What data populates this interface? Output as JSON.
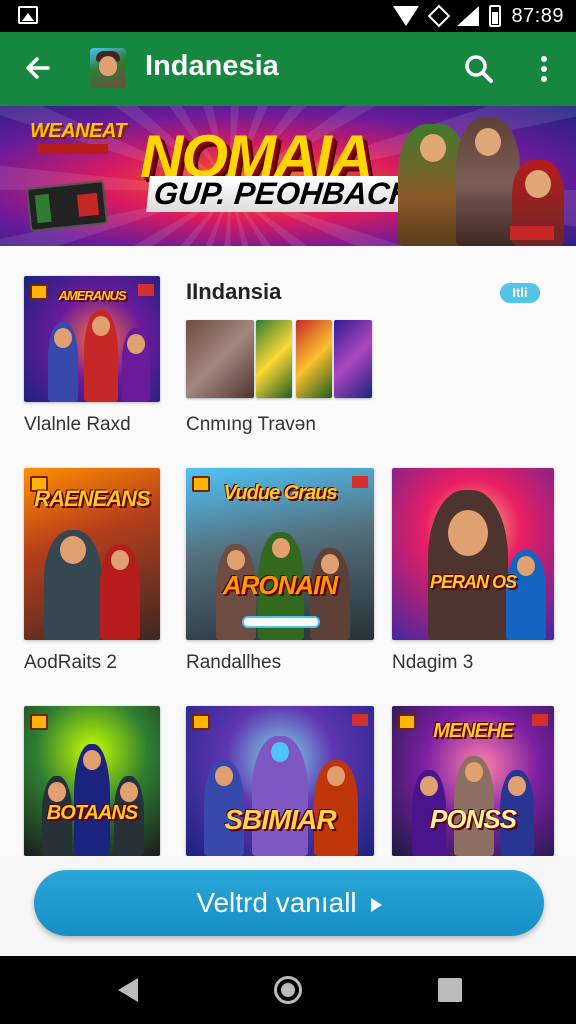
{
  "status_bar": {
    "time": "87:89"
  },
  "app_bar": {
    "title": "Indanesia"
  },
  "banner": {
    "badge": "WEANEAT",
    "title": "NOMAIA",
    "subtitle": "GUP. PEOHBACHUMS"
  },
  "featured": {
    "thumb_text": "AMERANUS",
    "title": "IIndansia",
    "chip": "Itli",
    "caption_left": "Vlalnle Raxd",
    "caption_right": "Cnmıng Travən"
  },
  "grid_row1": [
    {
      "tile_text": "RAENEANS",
      "caption": "AodRaits 2"
    },
    {
      "tile_text": "Vudue Graus",
      "lower_text": "ARONAIN",
      "caption": "Randallhes"
    },
    {
      "tile_text": "PERAN OS",
      "caption": "Ndagim 3"
    }
  ],
  "grid_row2": [
    {
      "tile_text": "BOTAANS"
    },
    {
      "tile_text": "SBIMIAR"
    },
    {
      "tile_text": "MENEHE",
      "lower_text": "PONSS"
    }
  ],
  "cta": {
    "label": "Veltrd vanıall"
  },
  "colors": {
    "app_bar": "#16873f",
    "cta": "#1f9bd1",
    "chip": "#53c3e6"
  }
}
